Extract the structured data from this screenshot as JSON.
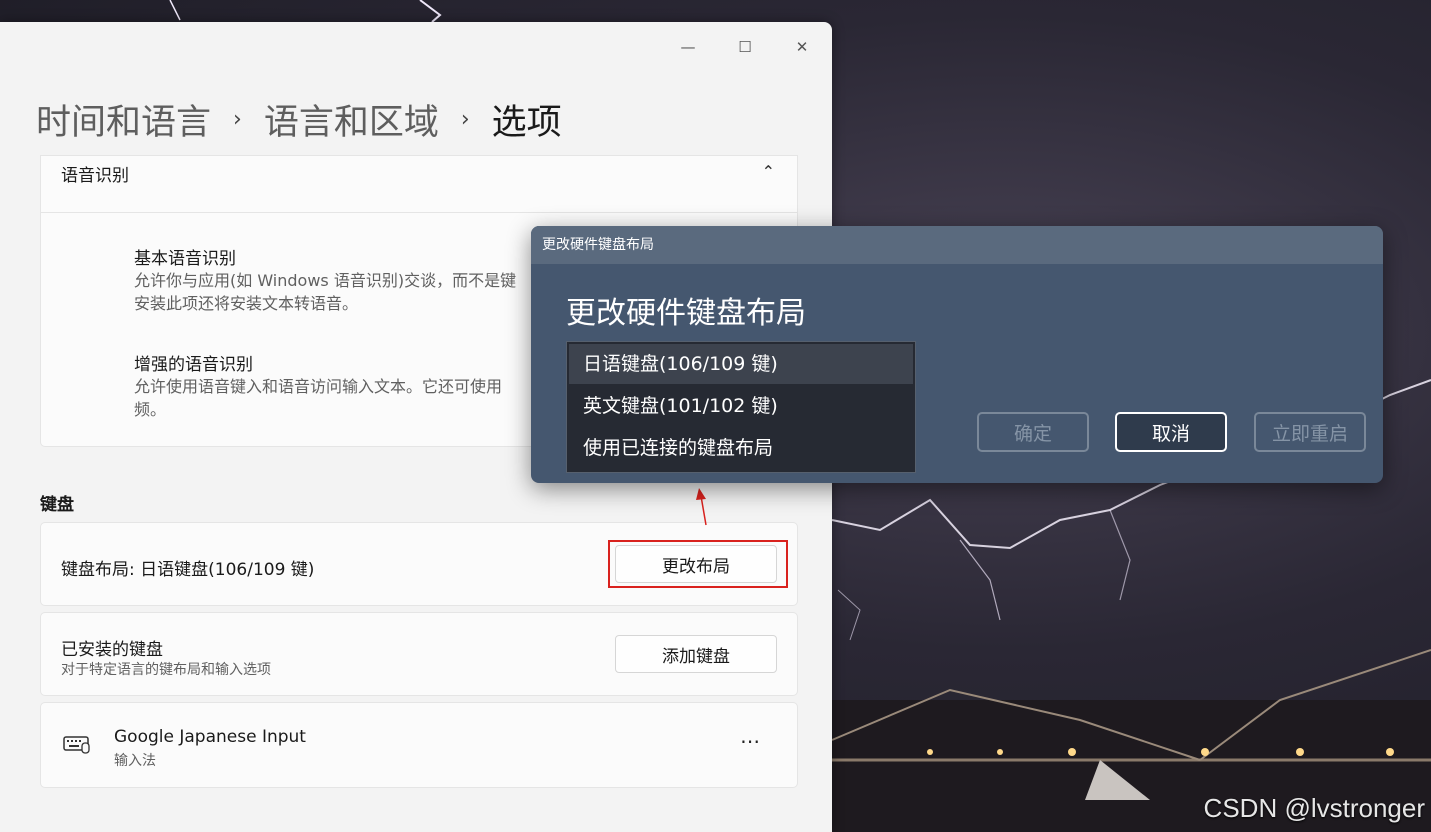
{
  "breadcrumb": {
    "level1": "时间和语言",
    "level2": "语言和区域",
    "level3": "选项",
    "separator": "›"
  },
  "window_controls": {
    "minimize": "—",
    "maximize": "☐",
    "close": "✕"
  },
  "speech": {
    "title": "语音识别",
    "collapse_glyph": "⌃",
    "basic": {
      "title": "基本语音识别",
      "desc_line1": "允许你与应用(如 Windows 语音识别)交谈，而不是键",
      "desc_line2": "安装此项还将安装文本转语音。"
    },
    "enhanced": {
      "title": "增强的语音识别",
      "desc_line1": "允许使用语音键入和语音访问输入文本。它还可使用",
      "desc_line2": "频。"
    }
  },
  "keyboard": {
    "section_label": "键盘",
    "layout": {
      "label": "键盘布局: 日语键盘(106/109 键)",
      "button": "更改布局"
    },
    "installed": {
      "title": "已安装的键盘",
      "subtitle": "对于特定语言的键布局和输入选项",
      "button": "添加键盘"
    },
    "ime": {
      "title": "Google Japanese Input",
      "subtitle": "输入法",
      "more": "⋯"
    }
  },
  "dialog": {
    "bar_title": "更改硬件键盘布局",
    "heading": "更改硬件键盘布局",
    "options": [
      "日语键盘(106/109 键)",
      "英文键盘(101/102 键)",
      "使用已连接的键盘布局"
    ],
    "selected_index": 0,
    "buttons": {
      "ok": "确定",
      "cancel": "取消",
      "restart": "立即重启"
    }
  },
  "watermark": "CSDN @lvstronger",
  "colors": {
    "highlight": "#d9221e",
    "dialog_bg": "#45576f",
    "window_bg": "#f3f3f3"
  }
}
